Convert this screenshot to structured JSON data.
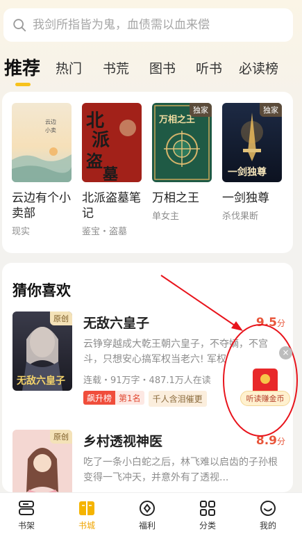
{
  "search": {
    "placeholder": "我剑所指皆为鬼，血债需以血来偿"
  },
  "tabs": [
    {
      "label": "推荐"
    },
    {
      "label": "热门"
    },
    {
      "label": "书荒"
    },
    {
      "label": "图书"
    },
    {
      "label": "听书"
    },
    {
      "label": "必读榜"
    }
  ],
  "featured": [
    {
      "title": "云边有个小卖部",
      "tag": "现实",
      "badge": ""
    },
    {
      "title": "北派盗墓笔记",
      "tag": "鉴宝・盗墓",
      "badge": ""
    },
    {
      "title": "万相之王",
      "tag": "单女主",
      "badge": "独家"
    },
    {
      "title": "一剑独尊",
      "tag": "杀伐果断",
      "badge": "独家"
    }
  ],
  "guess": {
    "heading": "猜你喜欢",
    "items": [
      {
        "badge": "原创",
        "title": "无敌六皇子",
        "score": "9.5",
        "score_unit": "分",
        "desc": "云铮穿越成大乾王朝六皇子，不夺嫡，不宫斗，只想安心搞军权当老六! 军权",
        "meta": "连载・91万字・487.1万人在读",
        "rank_a": "飙升榜",
        "rank_b": "第1名",
        "chip": "千人含泪催更"
      },
      {
        "badge": "原创",
        "title": "乡村透视神医",
        "score": "8.9",
        "score_unit": "分",
        "desc": "吃了一条小白蛇之后，林飞难以启齿的子孙根变得一飞冲天，并意外有了透视...",
        "meta": "",
        "rank_a": "",
        "rank_b": "",
        "chip": ""
      }
    ]
  },
  "floating": {
    "label": "听读赚金币",
    "close": "×"
  },
  "nav": [
    {
      "label": "书架"
    },
    {
      "label": "书城"
    },
    {
      "label": "福利"
    },
    {
      "label": "分类"
    },
    {
      "label": "我的"
    }
  ],
  "colors": {
    "accent": "#f7c21c",
    "score": "#e8553a",
    "annotation": "#e8141c"
  }
}
